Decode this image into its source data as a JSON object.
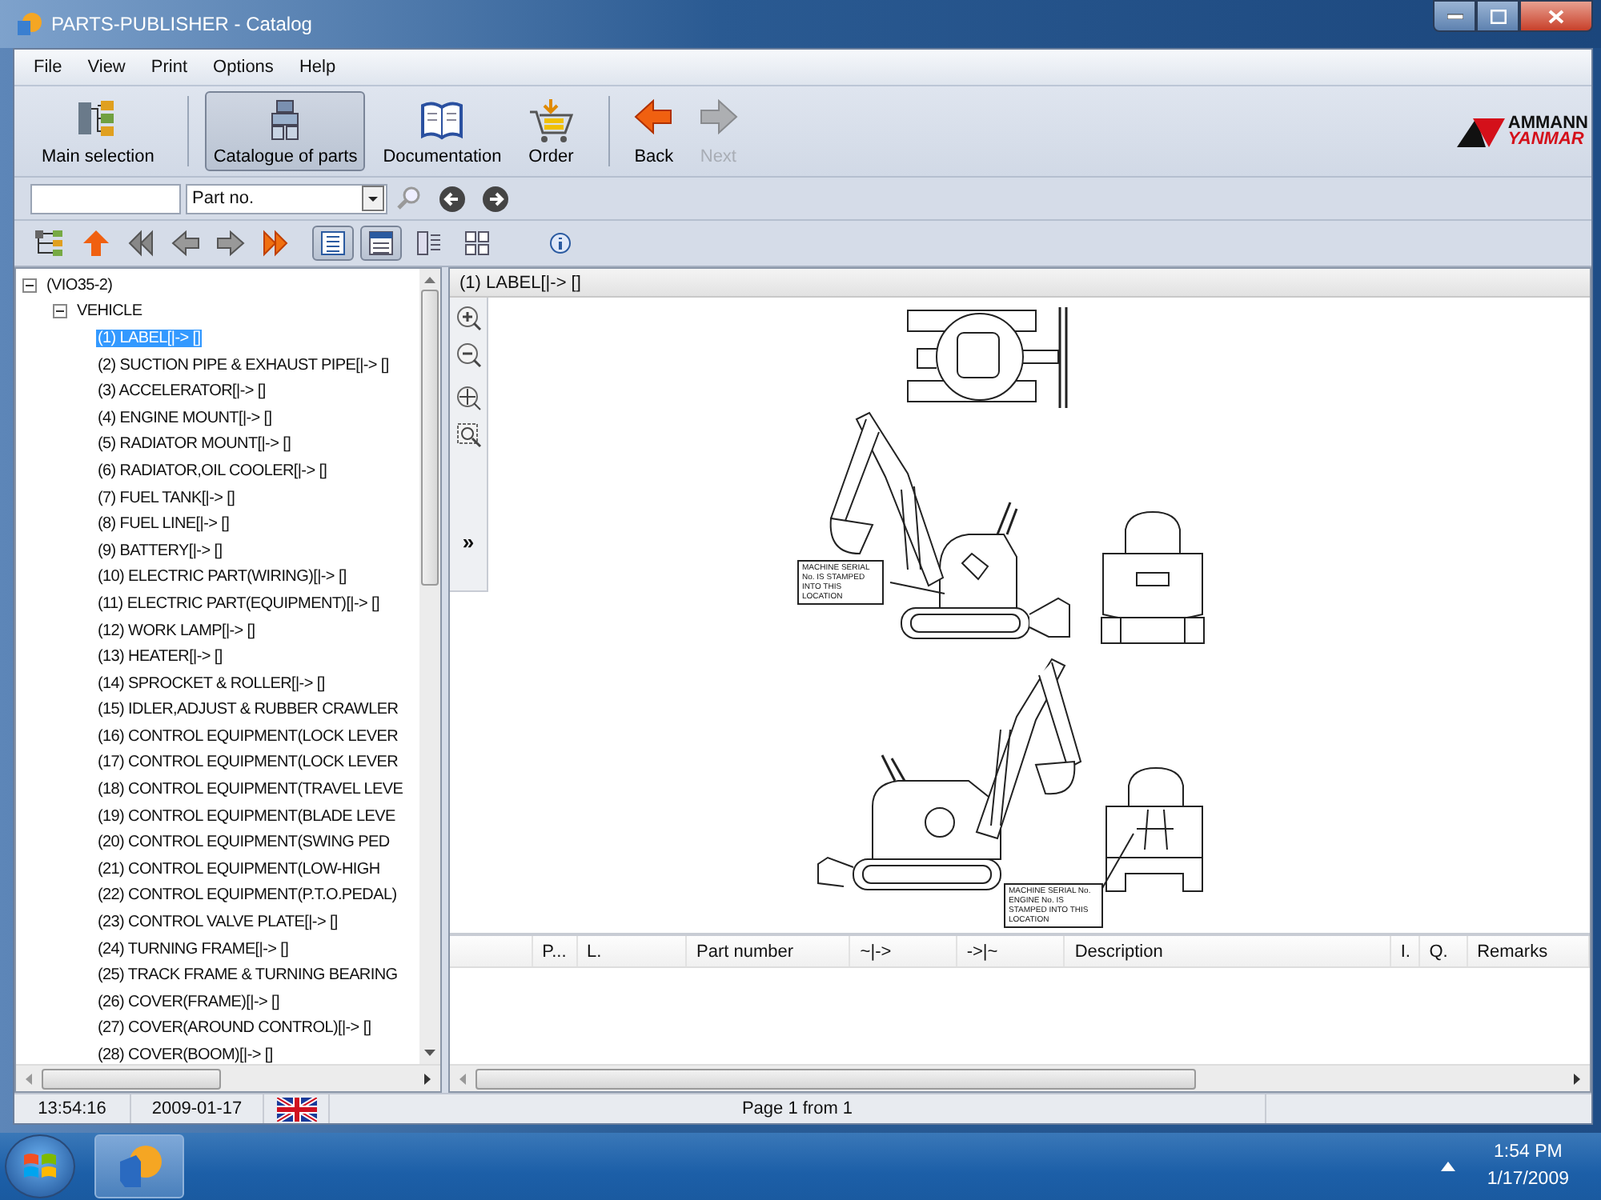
{
  "window": {
    "title": "PARTS-PUBLISHER - Catalog"
  },
  "menu": [
    "File",
    "View",
    "Print",
    "Options",
    "Help"
  ],
  "toolbar": {
    "buttons": [
      {
        "label": "Main selection",
        "selected": false,
        "disabled": false
      },
      {
        "label": "Catalogue of parts",
        "selected": true,
        "disabled": false
      },
      {
        "label": "Documentation",
        "selected": false,
        "disabled": false
      },
      {
        "label": "Order",
        "selected": false,
        "disabled": false
      },
      {
        "label": "Back",
        "selected": false,
        "disabled": false
      },
      {
        "label": "Next",
        "selected": false,
        "disabled": true
      }
    ],
    "logo": {
      "line1": "AMMANN",
      "line2": "YANMAR"
    }
  },
  "search": {
    "field_option": "Part no."
  },
  "view_toggles": [
    {
      "selected": true
    },
    {
      "selected": true
    },
    {
      "selected": false
    },
    {
      "selected": false
    }
  ],
  "tree": [
    {
      "label": "(VIO35-2)",
      "expanded": true,
      "selected": false,
      "children": [
        {
          "label": "VEHICLE",
          "expanded": true,
          "selected": false,
          "children": [
            {
              "label": "(1) LABEL[|-> []",
              "selected": true
            },
            {
              "label": "(2) SUCTION PIPE & EXHAUST PIPE[|-> []",
              "selected": false
            },
            {
              "label": "(3) ACCELERATOR[|-> []",
              "selected": false
            },
            {
              "label": "(4) ENGINE MOUNT[|-> []",
              "selected": false
            },
            {
              "label": "(5) RADIATOR MOUNT[|-> []",
              "selected": false
            },
            {
              "label": "(6) RADIATOR,OIL COOLER[|-> []",
              "selected": false
            },
            {
              "label": "(7) FUEL TANK[|-> []",
              "selected": false
            },
            {
              "label": "(8) FUEL LINE[|-> []",
              "selected": false
            },
            {
              "label": "(9) BATTERY[|-> []",
              "selected": false
            },
            {
              "label": "(10) ELECTRIC PART(WIRING)[|-> []",
              "selected": false
            },
            {
              "label": "(11) ELECTRIC PART(EQUIPMENT)[|-> []",
              "selected": false
            },
            {
              "label": "(12) WORK LAMP[|-> []",
              "selected": false
            },
            {
              "label": "(13) HEATER[|-> []",
              "selected": false
            },
            {
              "label": "(14) SPROCKET & ROLLER[|-> []",
              "selected": false
            },
            {
              "label": "(15) IDLER,ADJUST & RUBBER CRAWLER",
              "selected": false
            },
            {
              "label": "(16) CONTROL EQUIPMENT(LOCK LEVER",
              "selected": false
            },
            {
              "label": "(17) CONTROL EQUIPMENT(LOCK LEVER",
              "selected": false
            },
            {
              "label": "(18) CONTROL EQUIPMENT(TRAVEL LEVE",
              "selected": false
            },
            {
              "label": "(19) CONTROL EQUIPMENT(BLADE LEVE",
              "selected": false
            },
            {
              "label": "(20) CONTROL EQUIPMENT(SWING PED",
              "selected": false
            },
            {
              "label": "(21) CONTROL EQUIPMENT(LOW-HIGH",
              "selected": false
            },
            {
              "label": "(22) CONTROL EQUIPMENT(P.T.O.PEDAL)",
              "selected": false
            },
            {
              "label": "(23) CONTROL VALVE PLATE[|-> []",
              "selected": false
            },
            {
              "label": "(24) TURNING FRAME[|-> []",
              "selected": false
            },
            {
              "label": "(25) TRACK FRAME & TURNING BEARING",
              "selected": false
            },
            {
              "label": "(26) COVER(FRAME)[|-> []",
              "selected": false
            },
            {
              "label": "(27) COVER(AROUND CONTROL)[|-> []",
              "selected": false
            },
            {
              "label": "(28) COVER(BOOM)[|-> []",
              "selected": false
            }
          ]
        }
      ]
    }
  ],
  "detail": {
    "title": "(1) LABEL[|-> []",
    "expand_glyph": "»",
    "callouts": [
      "MACHINE SERIAL No. IS STAMPED INTO THIS LOCATION",
      "MACHINE SERIAL No. ENGINE No. IS STAMPED INTO THIS LOCATION"
    ]
  },
  "parts_table": {
    "columns": [
      "P...",
      "L.",
      "Part number",
      "~|->",
      "->|~",
      "Description",
      "I.",
      "Q.",
      "Remarks"
    ]
  },
  "status_bar": {
    "time": "13:54:16",
    "date": "2009-01-17",
    "page": "Page 1 from 1"
  },
  "taskbar": {
    "time": "1:54 PM",
    "date": "1/17/2009"
  }
}
